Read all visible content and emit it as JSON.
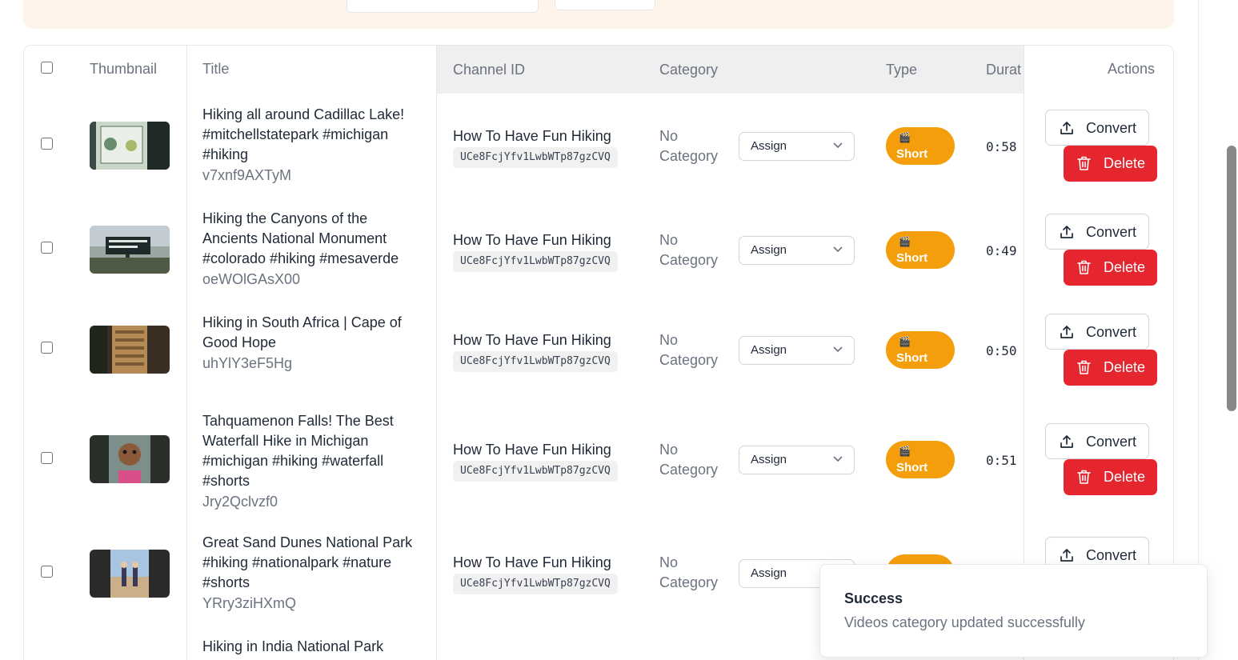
{
  "table": {
    "headers": {
      "thumbnail": "Thumbnail",
      "title": "Title",
      "channel_id": "Channel ID",
      "category": "Category",
      "type": "Type",
      "duration": "Durat",
      "actions": "Actions"
    },
    "rows": [
      {
        "title": "Hiking all around Cadillac Lake! #mitchellstatepark #michigan #hiking",
        "video_id": "v7xnf9AXTyM",
        "channel_name": "How To Have Fun Hiking",
        "channel_id": "UCe8FcjYfv1LwbWTp87gzCVQ",
        "category": "No Category",
        "assign_label": "Assign",
        "type_label": "Short",
        "duration": "0:58",
        "convert_label": "Convert",
        "delete_label": "Delete"
      },
      {
        "title": "Hiking the Canyons of the Ancients National Monument #colorado #hiking #mesaverde",
        "video_id": "oeWOlGAsX00",
        "channel_name": "How To Have Fun Hiking",
        "channel_id": "UCe8FcjYfv1LwbWTp87gzCVQ",
        "category": "No Category",
        "assign_label": "Assign",
        "type_label": "Short",
        "duration": "0:49",
        "convert_label": "Convert",
        "delete_label": "Delete"
      },
      {
        "title": "Hiking in South Africa | Cape of Good Hope",
        "video_id": "uhYlY3eF5Hg",
        "channel_name": "How To Have Fun Hiking",
        "channel_id": "UCe8FcjYfv1LwbWTp87gzCVQ",
        "category": "No Category",
        "assign_label": "Assign",
        "type_label": "Short",
        "duration": "0:50",
        "convert_label": "Convert",
        "delete_label": "Delete"
      },
      {
        "title": "Tahquamenon Falls! The Best Waterfall Hike in Michigan #michigan #hiking #waterfall #shorts",
        "video_id": "Jry2Qclvzf0",
        "channel_name": "How To Have Fun Hiking",
        "channel_id": "UCe8FcjYfv1LwbWTp87gzCVQ",
        "category": "No Category",
        "assign_label": "Assign",
        "type_label": "Short",
        "duration": "0:51",
        "convert_label": "Convert",
        "delete_label": "Delete"
      },
      {
        "title": "Great Sand Dunes National Park #hiking #nationalpark #nature #shorts",
        "video_id": "YRry3ziHXmQ",
        "channel_name": "How To Have Fun Hiking",
        "channel_id": "UCe8FcjYfv1LwbWTp87gzCVQ",
        "category": "No Category",
        "assign_label": "Assign",
        "convert_label": "Convert"
      },
      {
        "title": "Hiking in India National Park"
      }
    ]
  },
  "toast": {
    "title": "Success",
    "message": "Videos category updated successfully"
  },
  "colors": {
    "accent_orange": "#f59e0b",
    "delete_red": "#e5262e",
    "banner_bg": "#fff4ea",
    "header_bg": "#efefef"
  },
  "icons": {
    "type_glyph": "🎬"
  }
}
